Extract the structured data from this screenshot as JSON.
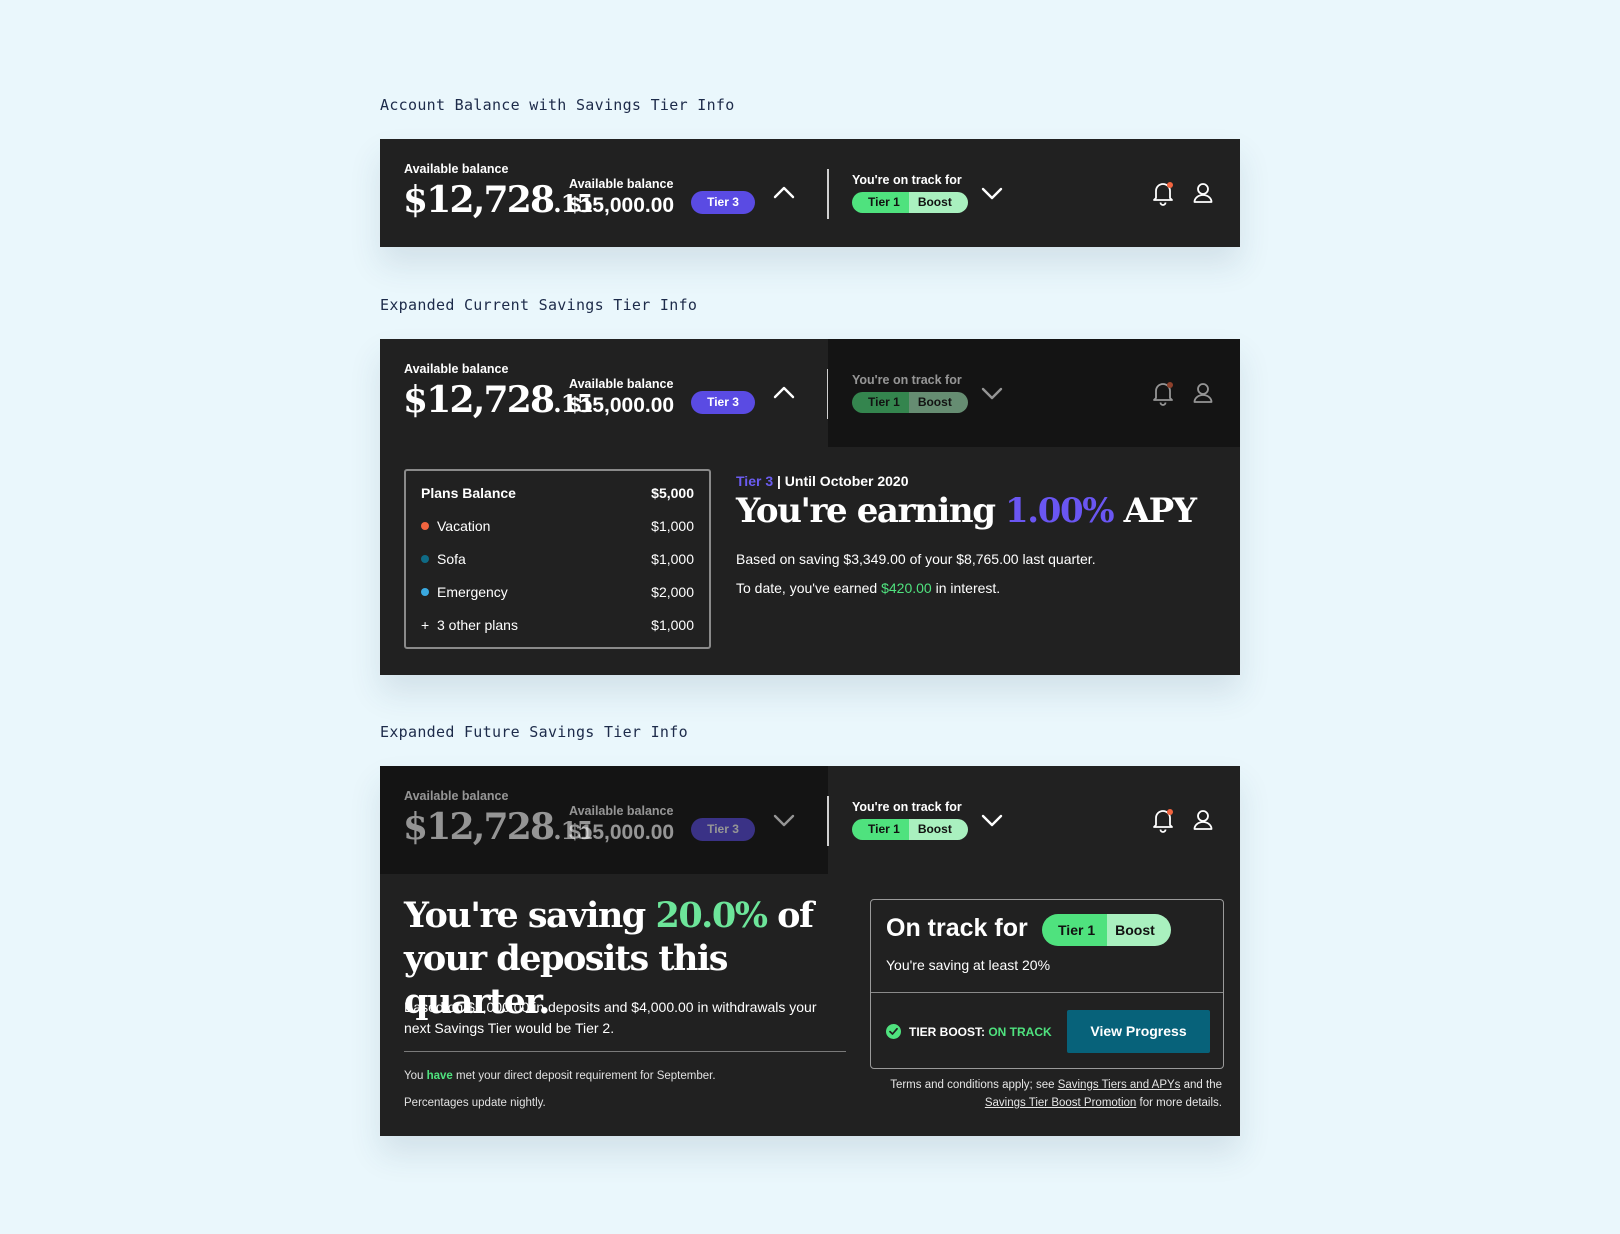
{
  "sections": [
    "Account Balance with Savings Tier Info",
    "Expanded Current Savings Tier Info",
    "Expanded Future Savings Tier Info"
  ],
  "header": {
    "balance_label": "Available balance",
    "balance_main": "$12,728",
    "balance_cents": ".15",
    "available_label": "Available balance",
    "available_value": "$15,000.00",
    "tier_badge": "Tier 3",
    "track_label": "You're on track for",
    "track_tier": "Tier 1",
    "track_boost": "Boost"
  },
  "plans": {
    "title": "Plans Balance",
    "total": "$5,000",
    "items": [
      {
        "name": "Vacation",
        "value": "$1,000",
        "color": "#f2643f"
      },
      {
        "name": "Sofa",
        "value": "$1,000",
        "color": "#0f6b86"
      },
      {
        "name": "Emergency",
        "value": "$2,000",
        "color": "#3aa9e0"
      },
      {
        "name": "3 other plans",
        "value": "$1,000",
        "color": ""
      }
    ]
  },
  "current": {
    "tier": "Tier 3",
    "until": " | Until October 2020",
    "earning_prefix": "You're earning ",
    "apy_pct": "1.00%",
    "apy_suffix": " APY",
    "line1": "Based on saving $3,349.00 of your $8,765.00 last quarter.",
    "line2_prefix": "To date, you've earned ",
    "line2_amount": "$420.00",
    "line2_suffix": " in interest."
  },
  "future": {
    "head_prefix": "You're saving ",
    "head_pct": "20.0%",
    "head_suffix": " of your deposits this quarter.",
    "sub": "Based on $5,000.00 in deposits and $4,000.00 in withdrawals your next  Savings Tier would be Tier 2.",
    "note1_prefix": "You ",
    "note1_have": "have",
    "note1_suffix": " met your direct deposit requirement for September.",
    "note2": "Percentages update nightly.",
    "box_title": "On track for",
    "box_tier": "Tier 1",
    "box_boost": "Boost",
    "box_sub": "You're saving at least 20%",
    "status_prefix": "TIER BOOST: ",
    "status_value": "ON TRACK",
    "view_button": "View Progress",
    "terms_prefix": "Terms and conditions apply; see ",
    "terms_link1": "Savings Tiers and APYs",
    "terms_mid": " and the ",
    "terms_link2": "Savings Tier Boost Promotion",
    "terms_suffix": " for more details."
  }
}
